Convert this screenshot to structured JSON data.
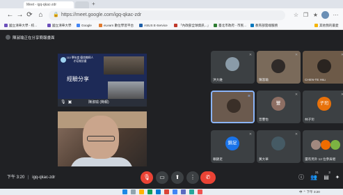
{
  "browser": {
    "tabs": [
      {
        "label": "Meet - igq-qkac-zdr",
        "active": true
      },
      {
        "label": "",
        "active": false
      }
    ],
    "new_tab": "+",
    "url": "https://meet.google.com/igq-qkac-zdr",
    "nav": {
      "back": "←",
      "forward": "→",
      "reload": "⟳",
      "home": "⌂"
    },
    "bookmarks": [
      {
        "label": "國立清華大學 - 校...",
        "color": "#6b4fbb"
      },
      {
        "label": "國立清華大學",
        "color": "#6b4fbb"
      },
      {
        "label": "Google",
        "color": "#4285f4"
      },
      {
        "label": "eLearn 數位學習平台",
        "color": "#e07a2e"
      },
      {
        "label": "ASUS E-Service",
        "color": "#1e5fa8"
      },
      {
        "label": "「內政部全球資訊...」",
        "color": "#c0392b"
      },
      {
        "label": "臺北市政府 - 市民...",
        "color": "#2e7d32"
      },
      {
        "label": "教育部雲端服務",
        "color": "#0277bd"
      },
      {
        "label": "其他我的最愛",
        "color": "#f4b400"
      }
    ]
  },
  "meet": {
    "presenter_label": "陳淑瑜正在分享簡報畫面",
    "slide": {
      "heading": "110 學年度 優良教師人才培育計畫",
      "title": "經驗分享",
      "footer_label": "陳淑瑜 (簡報)"
    },
    "participants": [
      {
        "name": "洪大維",
        "avatar_text": "",
        "color": "#5f6368"
      },
      {
        "name": "陳淑瑜",
        "avatar_text": "",
        "color": "#7a6a5a"
      },
      {
        "name": "CHEN-TE Hsu",
        "avatar_text": "",
        "color": "#6d5a48"
      },
      {
        "name": "",
        "avatar_text": "",
        "color": "#6b5a4e"
      },
      {
        "name": "曾豐怡",
        "avatar_text": "豐",
        "color": "#8d6e63"
      },
      {
        "name": "林子珩",
        "avatar_text": "子珩",
        "color": "#e8710a"
      },
      {
        "name": "賴錦足",
        "avatar_text": "錦足",
        "color": "#1a73e8"
      },
      {
        "name": "黃大華",
        "avatar_text": "",
        "color": "#455a64"
      },
      {
        "name": "還有另外 12 位參與者",
        "avatar_text": "",
        "color": "#5f6368"
      }
    ],
    "bottom": {
      "time": "下午 3:20",
      "meeting_code": "igq-qkac-zdr",
      "controls": [
        "mic-off",
        "camera",
        "present",
        "more",
        "end-call"
      ],
      "participant_count": "21",
      "chat_count": "3"
    }
  },
  "taskbar": {
    "tray_text": "中 ⌃ 下午 3:20"
  }
}
